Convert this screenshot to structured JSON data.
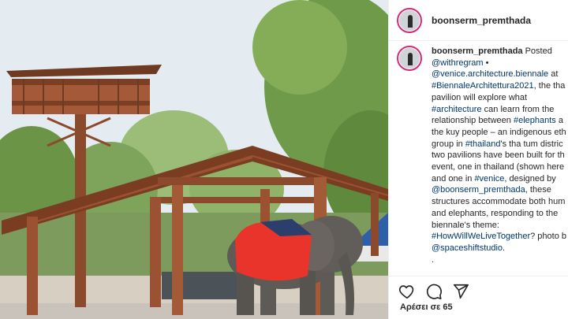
{
  "post": {
    "username": "boonserm_premthada",
    "caption": {
      "author": "boonserm_premthada",
      "posted": " Posted",
      "l2": "@withregram",
      "l2b": " •",
      "l3a": "@venice.architecture.biennale",
      "l3b": " at",
      "l4a": "#BiennaleArchitettura2021",
      "l4b": ", the tha",
      "l5": "pavilion will explore what",
      "l6a": "#architecture",
      "l6b": " can learn from the",
      "l7a": "relationship between ",
      "l7b": "#elephants",
      "l7c": " a",
      "l8": "the kuy people – an indigenous eth",
      "l9a": "group in ",
      "l9b": "#thailand",
      "l9c": "'s tha tum distric",
      "l10": "two pavilions have been built for th",
      "l11": "event, one in thailand (shown here",
      "l12a": "and one in ",
      "l12b": "#venice",
      "l12c": ", designed by",
      "l13a": "@boonserm_premthada",
      "l13b": ", these",
      "l14": "structures accommodate both hum",
      "l15": "and elephants, responding to the",
      "l16": "biennale's theme:",
      "l17a": "#HowWillWeLiveTogether",
      "l17b": "? photo b",
      "l18": "@spaceshiftstudio",
      "l18b": ".",
      "l19": "."
    },
    "likes": "Αρέσει σε 65",
    "icons": [
      "heart-icon",
      "comment-icon",
      "share-icon"
    ],
    "colors": {
      "link": "#00376b",
      "text": "#262626",
      "avatar_ring": "#d62976",
      "elephant_blanket": "#e8342a"
    }
  }
}
